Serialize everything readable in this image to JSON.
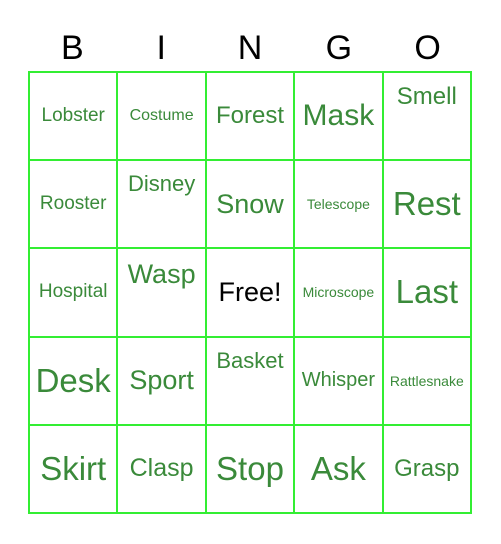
{
  "header": [
    "B",
    "I",
    "N",
    "G",
    "O"
  ],
  "colors": {
    "grid": "#33ee33",
    "text": "#3a8a3a",
    "free_text": "#000000"
  },
  "cells": [
    {
      "text": "Lobster",
      "size": "s"
    },
    {
      "text": "Costume",
      "size": "xs"
    },
    {
      "text": "Forest",
      "size": "m"
    },
    {
      "text": "Mask",
      "size": "l"
    },
    {
      "text": "Smell",
      "size": "m",
      "top": true
    },
    {
      "text": "Rooster",
      "size": "s"
    },
    {
      "text": "Disney",
      "size": "m-",
      "top": true
    },
    {
      "text": "Snow",
      "size": "l-"
    },
    {
      "text": "Telescope",
      "size": "xxs"
    },
    {
      "text": "Rest",
      "size": "xl"
    },
    {
      "text": "Hospital",
      "size": "s"
    },
    {
      "text": "Wasp",
      "size": "l-",
      "top": true
    },
    {
      "text": "Free!",
      "size": "l-",
      "free": true
    },
    {
      "text": "Microscope",
      "size": "xxs"
    },
    {
      "text": "Last",
      "size": "xl"
    },
    {
      "text": "Desk",
      "size": "xl"
    },
    {
      "text": "Sport",
      "size": "l-"
    },
    {
      "text": "Basket",
      "size": "m-",
      "top": true
    },
    {
      "text": "Whisper",
      "size": "s+"
    },
    {
      "text": "Rattlesnake",
      "size": "xxs"
    },
    {
      "text": "Skirt",
      "size": "xl"
    },
    {
      "text": "Clasp",
      "size": "m+"
    },
    {
      "text": "Stop",
      "size": "xl"
    },
    {
      "text": "Ask",
      "size": "xl"
    },
    {
      "text": "Grasp",
      "size": "m"
    }
  ]
}
